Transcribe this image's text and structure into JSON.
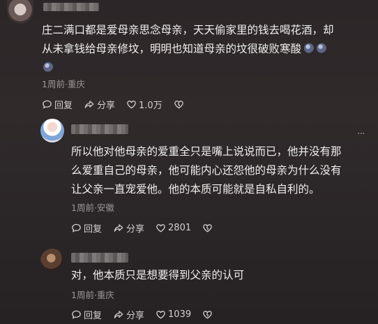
{
  "comments": [
    {
      "text_line1": "庄二满口都是爱母亲思念母亲，天天偷家里的钱去喝花酒，却",
      "text_line2": "从未拿钱给母亲修坟，明明也知道母亲的坟很破败寒酸",
      "meta": "1周前·重庆",
      "reply_label": "回复",
      "share_label": "分享",
      "likes": "1.0万"
    },
    {
      "text_line1": "所以他对他母亲的爱重全只是嘴上说说而已，他并没有那",
      "text_line2": "么爱重自己的母亲，他可能内心还怨他的母亲为什么没有",
      "text_line3": "让父亲一直宠爱他。他的本质可能就是自私自利的。",
      "meta": "1周前·安徽",
      "reply_label": "回复",
      "share_label": "分享",
      "likes": "2801"
    },
    {
      "text_line1": "对，他本质只是想要得到父亲的认可",
      "meta": "1周前·重庆",
      "reply_label": "回复",
      "share_label": "分享",
      "likes": "1039"
    }
  ],
  "icons": {
    "reply": "comment-bubble-icon",
    "share": "share-arrow-icon",
    "like": "heart-icon",
    "dislike": "broken-heart-icon",
    "more": "more-dots-icon"
  }
}
